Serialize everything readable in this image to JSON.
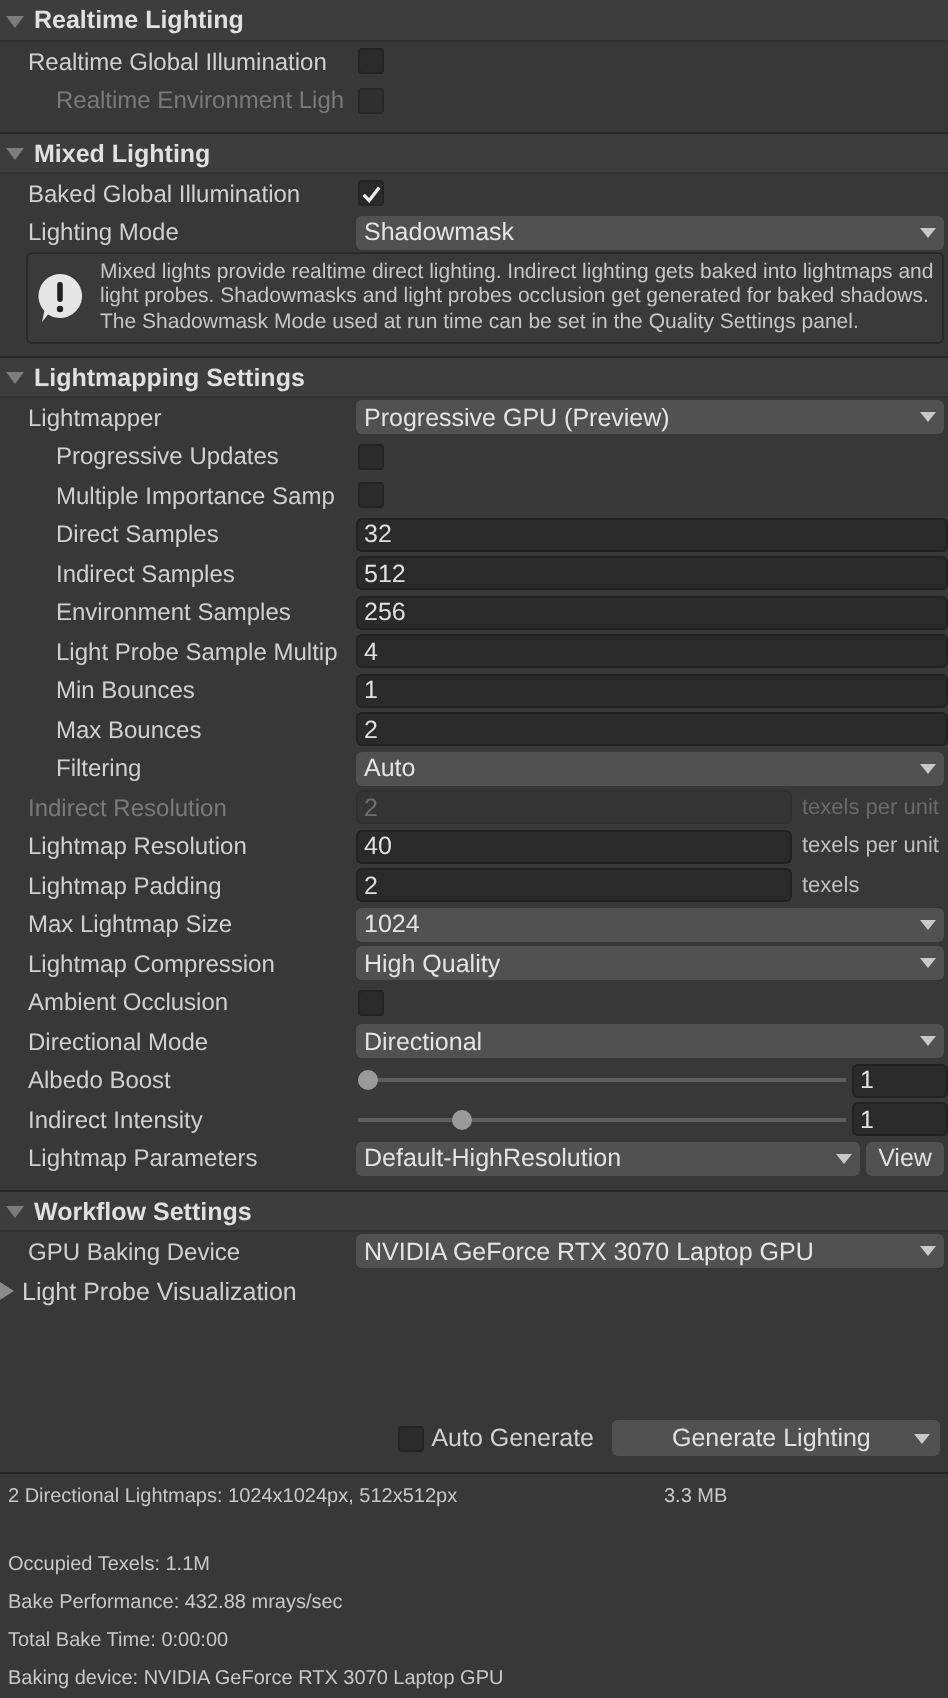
{
  "sections": [
    {
      "title": "Realtime Lighting",
      "expanded": true,
      "rows": [
        {
          "kind": "checkbox",
          "label": "Realtime Global Illumination",
          "checked": false,
          "disabled": false,
          "children": [
            {
              "kind": "checkbox",
              "label": "Realtime Environment Ligh",
              "checked": false,
              "disabled": true
            }
          ]
        }
      ]
    },
    {
      "title": "Mixed Lighting",
      "expanded": true,
      "rows": [
        {
          "kind": "checkbox",
          "label": "Baked Global Illumination",
          "checked": true,
          "disabled": false
        },
        {
          "kind": "dropdown",
          "label": "Lighting Mode",
          "value": "Shadowmask",
          "disabled": false
        },
        {
          "kind": "help",
          "text": "Mixed lights provide realtime direct lighting. Indirect lighting gets baked into lightmaps and light probes. Shadowmasks and light probes occlusion get generated for baked shadows. The Shadowmask Mode used at run time can be set in the Quality Settings panel."
        }
      ]
    },
    {
      "title": "Lightmapping Settings",
      "expanded": true,
      "rows": [
        {
          "kind": "dropdown",
          "label": "Lightmapper",
          "value": "Progressive GPU (Preview)",
          "disabled": false,
          "children": [
            {
              "kind": "checkbox",
              "label": "Progressive Updates",
              "checked": false,
              "disabled": false
            },
            {
              "kind": "checkbox",
              "label": "Multiple Importance Samp",
              "checked": false,
              "disabled": false
            },
            {
              "kind": "number",
              "label": "Direct Samples",
              "value": "32",
              "disabled": false
            },
            {
              "kind": "number",
              "label": "Indirect Samples",
              "value": "512",
              "disabled": false
            },
            {
              "kind": "number",
              "label": "Environment Samples",
              "value": "256",
              "disabled": false
            },
            {
              "kind": "number",
              "label": "Light Probe Sample Multip",
              "value": "4",
              "disabled": false
            },
            {
              "kind": "number",
              "label": "Min Bounces",
              "value": "1",
              "disabled": false
            },
            {
              "kind": "number",
              "label": "Max Bounces",
              "value": "2",
              "disabled": false
            },
            {
              "kind": "dropdown",
              "label": "Filtering",
              "value": "Auto",
              "disabled": false
            }
          ]
        },
        {
          "kind": "number",
          "label": "Indirect Resolution",
          "value": "2",
          "unit": "texels per unit",
          "disabled": true
        },
        {
          "kind": "number",
          "label": "Lightmap Resolution",
          "value": "40",
          "unit": "texels per unit",
          "disabled": false
        },
        {
          "kind": "number",
          "label": "Lightmap Padding",
          "value": "2",
          "unit": "texels",
          "disabled": false
        },
        {
          "kind": "dropdown",
          "label": "Max Lightmap Size",
          "value": "1024",
          "disabled": false
        },
        {
          "kind": "dropdown",
          "label": "Lightmap Compression",
          "value": "High Quality",
          "disabled": false
        },
        {
          "kind": "checkbox",
          "label": "Ambient Occlusion",
          "checked": false,
          "disabled": false
        },
        {
          "kind": "dropdown",
          "label": "Directional Mode",
          "value": "Directional",
          "disabled": false
        },
        {
          "kind": "slider",
          "label": "Albedo Boost",
          "value": "1",
          "level": 0,
          "disabled": false
        },
        {
          "kind": "slider",
          "label": "Indirect Intensity",
          "value": "1",
          "level": 0.2,
          "disabled": false
        },
        {
          "kind": "dropdown_button",
          "label": "Lightmap Parameters",
          "value": "Default-HighResolution",
          "button": "View",
          "disabled": false
        }
      ]
    },
    {
      "title": "Workflow Settings",
      "expanded": true,
      "rows": [
        {
          "kind": "dropdown",
          "label": "GPU Baking Device",
          "value": "NVIDIA GeForce RTX 3070 Laptop GPU",
          "disabled": false
        },
        {
          "kind": "foldout",
          "label": "Light Probe Visualization",
          "expanded": false,
          "disabled": false
        }
      ]
    }
  ],
  "auto_generate": {
    "label": "Auto Generate",
    "checked": false
  },
  "generate_button": {
    "label": "Generate Lighting"
  },
  "stats": {
    "lightmaps": "2 Directional Lightmaps: 1024x1024px, 512x512px",
    "size": "3.3 MB",
    "lines": [
      "Occupied Texels: 1.1M",
      "Bake Performance: 432.88 mrays/sec",
      "Total Bake Time: 0:00:00",
      "Baking device: NVIDIA GeForce RTX 3070 Laptop GPU"
    ]
  }
}
